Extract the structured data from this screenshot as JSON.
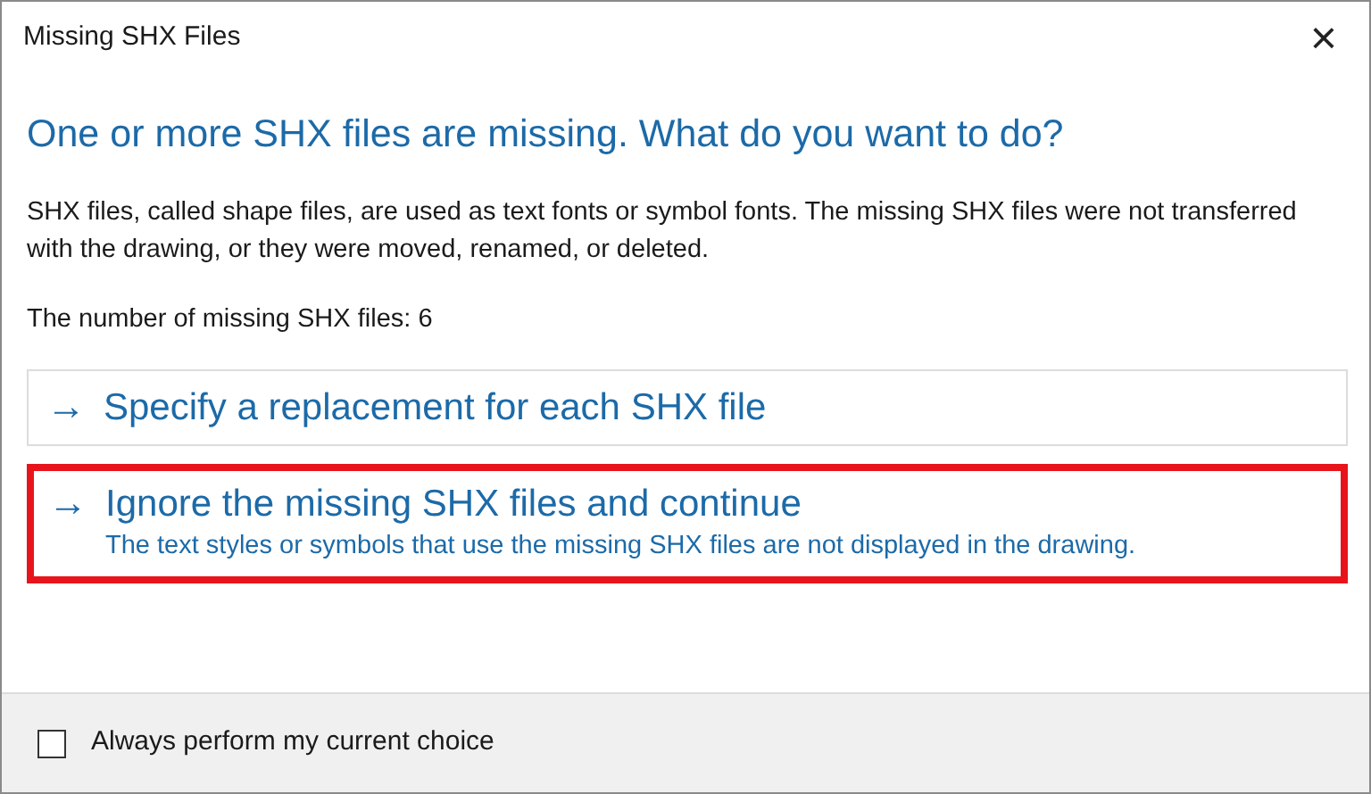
{
  "window": {
    "title": "Missing SHX Files",
    "close": "×"
  },
  "heading": "One or more SHX files are missing. What do you want to do?",
  "description": "SHX files, called shape files, are used as text fonts or symbol fonts. The missing SHX files were not transferred with the drawing, or they were moved, renamed, or deleted.",
  "count_text": "The number of missing SHX files: 6",
  "options": [
    {
      "arrow": "→",
      "title": "Specify a replacement for each SHX file",
      "highlighted": false
    },
    {
      "arrow": "→",
      "title": "Ignore the missing SHX files and continue",
      "detail": "The text styles or symbols that use the missing SHX files are not displayed in the drawing.",
      "highlighted": true
    }
  ],
  "footer": {
    "checkbox": {
      "label": "Always perform my current choice",
      "checked": false
    }
  }
}
